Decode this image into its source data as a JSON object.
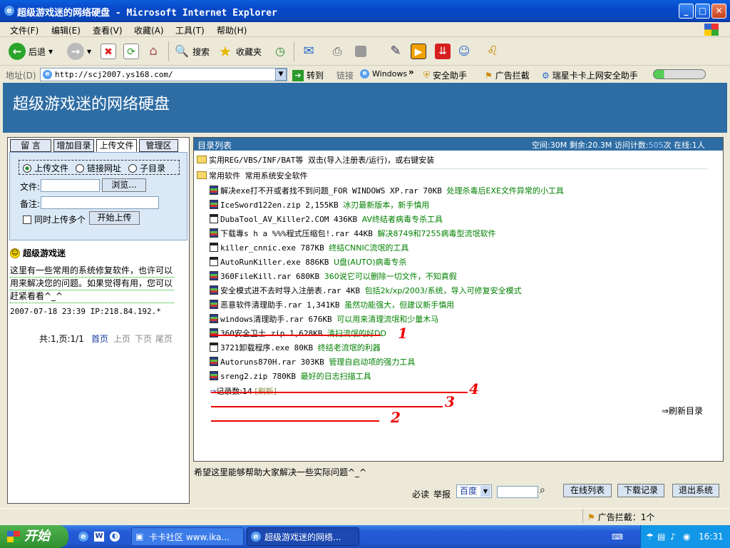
{
  "window": {
    "title": "超级游戏迷的网络硬盘 - Microsoft Internet Explorer",
    "min": "_",
    "max": "□",
    "close": "✕"
  },
  "menu": [
    "文件(F)",
    "编辑(E)",
    "查看(V)",
    "收藏(A)",
    "工具(T)",
    "帮助(H)"
  ],
  "toolbar": {
    "back": "后退",
    "search": "搜索",
    "favorites": "收藏夹"
  },
  "address": {
    "label": "地址(D)",
    "url": "http://scj2007.ys168.com/",
    "go": "转到",
    "links": "链接",
    "windows": "Windows",
    "chevron": "»",
    "security": "安全助手",
    "adblock": "广告拦截",
    "rising": "瑞星卡卡上网安全助手"
  },
  "site": {
    "title": "超级游戏迷的网络硬盘"
  },
  "tabs": [
    "留 言",
    "增加目录",
    "上传文件",
    "管理区"
  ],
  "upload": {
    "radios": [
      "上传文件",
      "链接网址",
      "子目录"
    ],
    "file_label": "文件:",
    "browse": "浏览...",
    "note_label": "备注:",
    "multi": "同时上传多个",
    "submit": "开始上传"
  },
  "owner": {
    "name": "超级游戏迷",
    "message": "这里有一些常用的系统修复软件，也许可以用来解决您的问题。如果觉得有用，您可以no赶紧看看^_^",
    "lines": [
      "这里有一些常用的系统修复软件，也许可以",
      "用来解决您的问题。如果觉得有用，您可以",
      "赶紧看看^_^"
    ],
    "meta": "2007-07-18 23:39 IP:218.84.192.*"
  },
  "pager": {
    "summary": "共:1,页:1/1",
    "first": "首页",
    "prev": "上页",
    "next": "下页",
    "last": "尾页"
  },
  "list": {
    "header": "目录列表",
    "stats": "空间:30M 剩余:20.3M 访问计数:",
    "visits": "505",
    "stats_tail": "次 在线:1人",
    "folders": [
      {
        "name": "实用REG/VBS/INF/BAT等",
        "desc": "双击(导入注册表/运行)，或右键安装"
      },
      {
        "name": "常用软件",
        "desc": "常用系统安全软件"
      }
    ],
    "files": [
      {
        "icon": "rar",
        "name": "解决exe打不开或者找不到问题_FOR WINDOWS XP.rar",
        "size": "70KB",
        "desc": "处理杀毒后EXE文件异常的小工具"
      },
      {
        "icon": "rar",
        "name": "IceSword122en.zip",
        "size": "2,155KB",
        "desc": "冰刃最新版本，新手慎用"
      },
      {
        "icon": "exe",
        "name": "DubaTool_AV_Killer2.COM",
        "size": "436KB",
        "desc": "AV终结者病毒专杀工具"
      },
      {
        "icon": "rar",
        "name": "下载專s h a %%%程式压缩包!.rar",
        "size": "44KB",
        "desc": "解决8749和7255病毒型流氓软件"
      },
      {
        "icon": "exe",
        "name": "killer_cnnic.exe",
        "size": "787KB",
        "desc": "终结CNNIC流氓的工具"
      },
      {
        "icon": "exe",
        "name": "AutoRunKiller.exe",
        "size": "886KB",
        "desc": "U盘(AUTO)病毒专杀"
      },
      {
        "icon": "rar",
        "name": "360FileKill.rar",
        "size": "680KB",
        "desc": "360说它可以删除一切文件，不知真假"
      },
      {
        "icon": "rar",
        "name": "安全模式进不去时导入注册表.rar",
        "size": "4KB",
        "desc": "包括2k/xp/2003/系统，导入可修复安全模式"
      },
      {
        "icon": "rar",
        "name": "恶意软件清理助手.rar",
        "size": "1,341KB",
        "desc": "虽然功能强大，但建议新手慎用"
      },
      {
        "icon": "rar",
        "name": "windows清理助手.rar",
        "size": "676KB",
        "desc": "可以用来清理流氓和少量木马"
      },
      {
        "icon": "rar",
        "name": "360安全卫士.zip",
        "size": "1,628KB",
        "desc": "清扫流氓的好DD"
      },
      {
        "icon": "exe",
        "name": "3721卸载程序.exe",
        "size": "80KB",
        "desc": "终结老流氓的利器"
      },
      {
        "icon": "rar",
        "name": "Autoruns870H.rar",
        "size": "303KB",
        "desc": "管理自启动项的强力工具"
      },
      {
        "icon": "rar",
        "name": "sreng2.zip",
        "size": "780KB",
        "desc": "最好的日志扫描工具"
      }
    ],
    "count_label": "记录数:14",
    "refresh_small": "[刷新]",
    "refresh_dir": "⇒刷新目录",
    "annotations": [
      "1",
      "4",
      "3",
      "2"
    ]
  },
  "footer": {
    "note": "希望这里能够帮助大家解决一些实际问题^_^",
    "must_read": "必读",
    "report": "举报",
    "engine": "百度",
    "online": "在线列表",
    "downloads": "下载记录",
    "logout": "退出系统"
  },
  "status": {
    "adblock": "广告拦截：1个"
  },
  "taskbar": {
    "start": "开始",
    "tasks": [
      "卡卡社区 www.ika...",
      "超级游戏迷的网络..."
    ],
    "clock": "16:31"
  },
  "colors": {
    "header_blue": "#2e6da4",
    "desc_green": "#008000",
    "annotation_red": "#e00000"
  }
}
